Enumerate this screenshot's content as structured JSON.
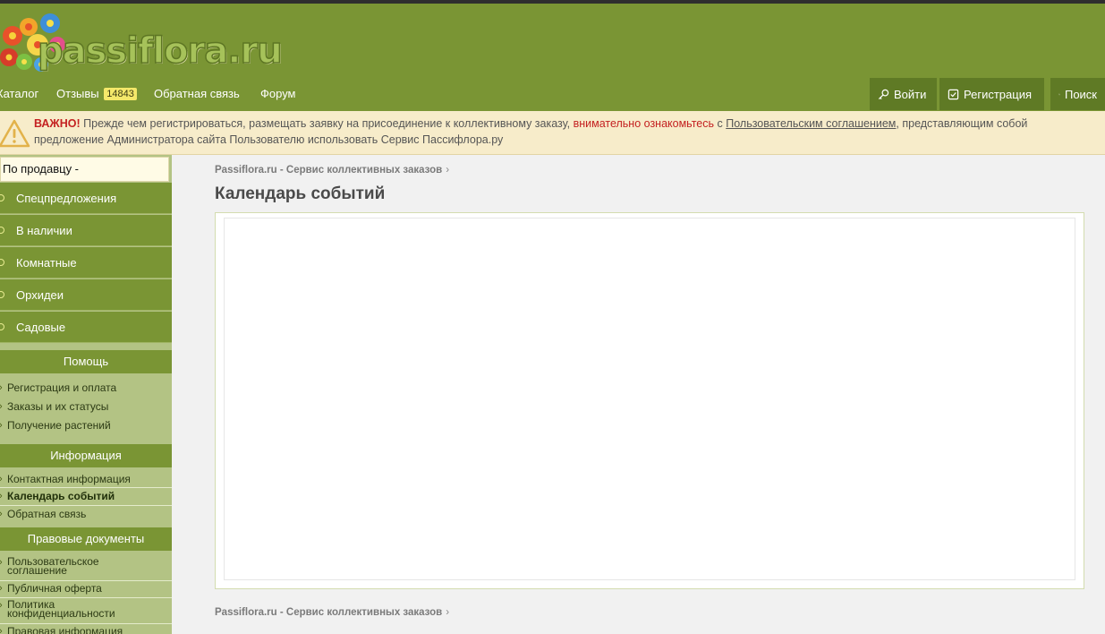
{
  "site": {
    "logo_text": "passiflora.ru"
  },
  "nav": {
    "catalog": "Каталог",
    "reviews": "Отзывы",
    "reviews_count": "14843",
    "feedback": "Обратная связь",
    "forum": "Форум",
    "login": "Войти",
    "register": "Регистрация",
    "search": "Поиск"
  },
  "notice": {
    "important": "ВАЖНО!",
    "text1": " Прежде чем регистрироваться, размещать заявку на присоединение к коллективному заказу, ",
    "emphasis": "внимательно ознакомьтесь",
    "text2": " с ",
    "link": "Пользовательским соглашением",
    "text3": ", представляющим собой предложение Администратора сайта Пользователю использовать Сервис Пассифлора.ру"
  },
  "sidebar": {
    "seller_select": "По продавцу -",
    "categories": [
      "Спецпредложения",
      "В наличии",
      "Комнатные",
      "Орхидеи",
      "Садовые"
    ],
    "help": {
      "title": "Помощь",
      "links": [
        "Регистрация и оплата",
        "Заказы и их статусы",
        "Получение растений"
      ]
    },
    "info": {
      "title": "Информация",
      "links": [
        "Контактная информация",
        "Календарь событий",
        "Обратная связь"
      ]
    },
    "legal": {
      "title": "Правовые документы",
      "links": [
        "Пользовательское соглашение",
        "Публичная оферта",
        "Политика конфиденциальности",
        "Правовая информация"
      ]
    }
  },
  "main": {
    "breadcrumb": "Passiflora.ru - Сервис коллективных заказов",
    "title": "Календарь событий"
  },
  "colors": {
    "header_green": "#7a9534",
    "button_green": "#5f7a25",
    "sidebar_light": "#b3c384",
    "notice_bg": "#f7ecca",
    "badge_yellow": "#f4e86a",
    "alert_red": "#c42121"
  },
  "icons": {
    "logo": "flower-cluster-icon",
    "login": "key-icon",
    "register": "checkbox-icon",
    "search": "search-icon",
    "notice": "warning-icon",
    "category_bullet": "circle-bullet-icon",
    "link_bullet": "chevron-right-icon"
  }
}
